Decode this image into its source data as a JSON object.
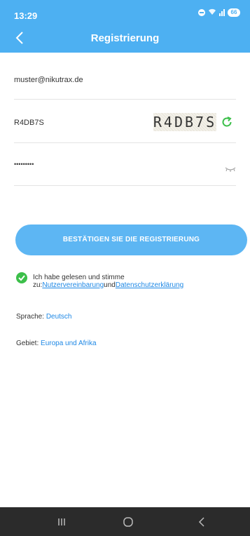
{
  "status_bar": {
    "time": "13:29",
    "battery": "66"
  },
  "header": {
    "title": "Registrierung"
  },
  "form": {
    "email": "muster@nikutrax.de",
    "captcha_value": "R4DB7S",
    "captcha_image_text": "R4DB7S",
    "password_masked": "•••••••••"
  },
  "confirm_button": {
    "label": "BESTÄTIGEN SIE DIE REGISTRIERUNG"
  },
  "agreement": {
    "checked": true,
    "line1": "Ich habe gelesen und stimme",
    "prefix": "zu:",
    "user_agreement_link": "Nutzervereinbarung",
    "conjunction": "und",
    "privacy_link": "Datenschutzerklärung"
  },
  "language": {
    "label": "Sprache:",
    "value": "Deutsch"
  },
  "region": {
    "label": "Gebiet:",
    "value": "Europa und Afrika"
  },
  "colors": {
    "header": "#4db0f2",
    "accent": "#1e88e5",
    "button": "#5db6f3",
    "check": "#3cbf4a",
    "refresh": "#3cbf4a",
    "nav_bar": "#2b2b2b"
  }
}
